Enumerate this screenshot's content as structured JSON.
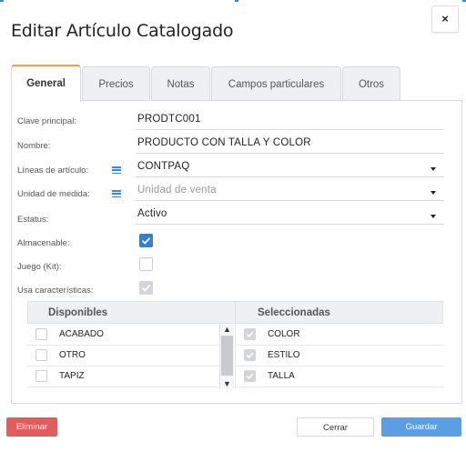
{
  "dialog": {
    "title": "Editar Artículo Catalogado",
    "close_label": "×"
  },
  "tabs": [
    {
      "label": "General",
      "active": true
    },
    {
      "label": "Precios",
      "active": false
    },
    {
      "label": "Notas",
      "active": false
    },
    {
      "label": "Campos particulares",
      "active": false
    },
    {
      "label": "Otros",
      "active": false
    }
  ],
  "form": {
    "clave": {
      "label": "Clave principal:",
      "value": "PRODTC001"
    },
    "nombre": {
      "label": "Nombre:",
      "value": "PRODUCTO CON TALLA Y COLOR"
    },
    "lineas": {
      "label": "Líneas de artículo:",
      "value": "CONTPAQ"
    },
    "unidad": {
      "label": "Unidad de medida:",
      "placeholder": "Unidad de venta"
    },
    "estatus": {
      "label": "Estatus:",
      "value": "Activo"
    },
    "almacenable": {
      "label": "Almacenable:",
      "checked": true
    },
    "juego": {
      "label": "Juego (Kit):",
      "checked": false
    },
    "usa_caracteristicas": {
      "label": "Usa características:",
      "checked": true,
      "disabled": true
    }
  },
  "dual_list": {
    "available_header": "Disponibles",
    "selected_header": "Seleccionadas",
    "available": [
      {
        "label": "ACABADO",
        "checked": false
      },
      {
        "label": "OTRO",
        "checked": false
      },
      {
        "label": "TAPIZ",
        "checked": false
      }
    ],
    "selected": [
      {
        "label": "COLOR",
        "checked": true
      },
      {
        "label": "ESTILO",
        "checked": true
      },
      {
        "label": "TALLA",
        "checked": true
      }
    ]
  },
  "footer": {
    "delete_label": "Eliminar",
    "close_label": "Cerrar",
    "save_label": "Guardar"
  },
  "colors": {
    "primary": "#2f7ed8",
    "save_button": "#5c9ee3",
    "delete_button": "#e25c5c",
    "active_tab_accent": "#f0a04b"
  }
}
